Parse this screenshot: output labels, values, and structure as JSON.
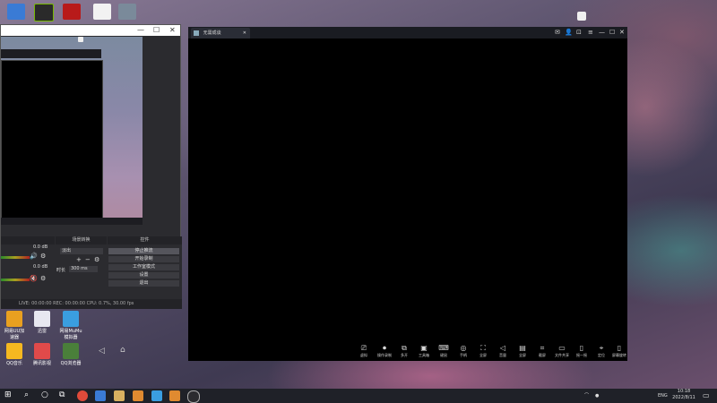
{
  "desktop": {
    "top_icons": [
      "computer-icon",
      "nvidia-icon",
      "app-red-icon",
      "document-icon",
      "gallery-icon"
    ],
    "left_icons": [
      {
        "label": "网易UU加速器",
        "color": "#e9a020"
      },
      {
        "label": "迅雷",
        "color": "#e8e8f0"
      },
      {
        "label": "网易MuMu模拟器",
        "color": "#3a9ee0"
      },
      {
        "label": "QQ音乐",
        "color": "#f5b820"
      },
      {
        "label": "腾讯影视",
        "color": "#e04a4a"
      },
      {
        "label": "QQ浏览器",
        "color": "#4a7f3a"
      }
    ]
  },
  "obs": {
    "mixer_values": [
      "0.0 dB",
      "0.0 dB"
    ],
    "dock_titles": [
      "场景转换",
      "控件"
    ],
    "transition": {
      "name": "淡出",
      "duration_label": "时长",
      "duration": "300 ms"
    },
    "controls": [
      "停止推流",
      "开始录制",
      "工作室模式",
      "设置",
      "退出"
    ],
    "status": "LIVE: 00:00:00   REC: 00:00:00   CPU: 0.7%, 30.00 fps"
  },
  "emulator": {
    "tab_title": "无需成谈",
    "toolbar": [
      "虚拟",
      "操作录制",
      "多开",
      "工具箱",
      "键鼠",
      "手柄",
      "全屏",
      "音量",
      "全屏",
      "截屏",
      "文件共享",
      "摇一摇",
      "定位",
      "屏幕旋转"
    ]
  },
  "taskbar": {
    "time": "10:18",
    "date": "2022/8/11",
    "lang": "ENG"
  }
}
